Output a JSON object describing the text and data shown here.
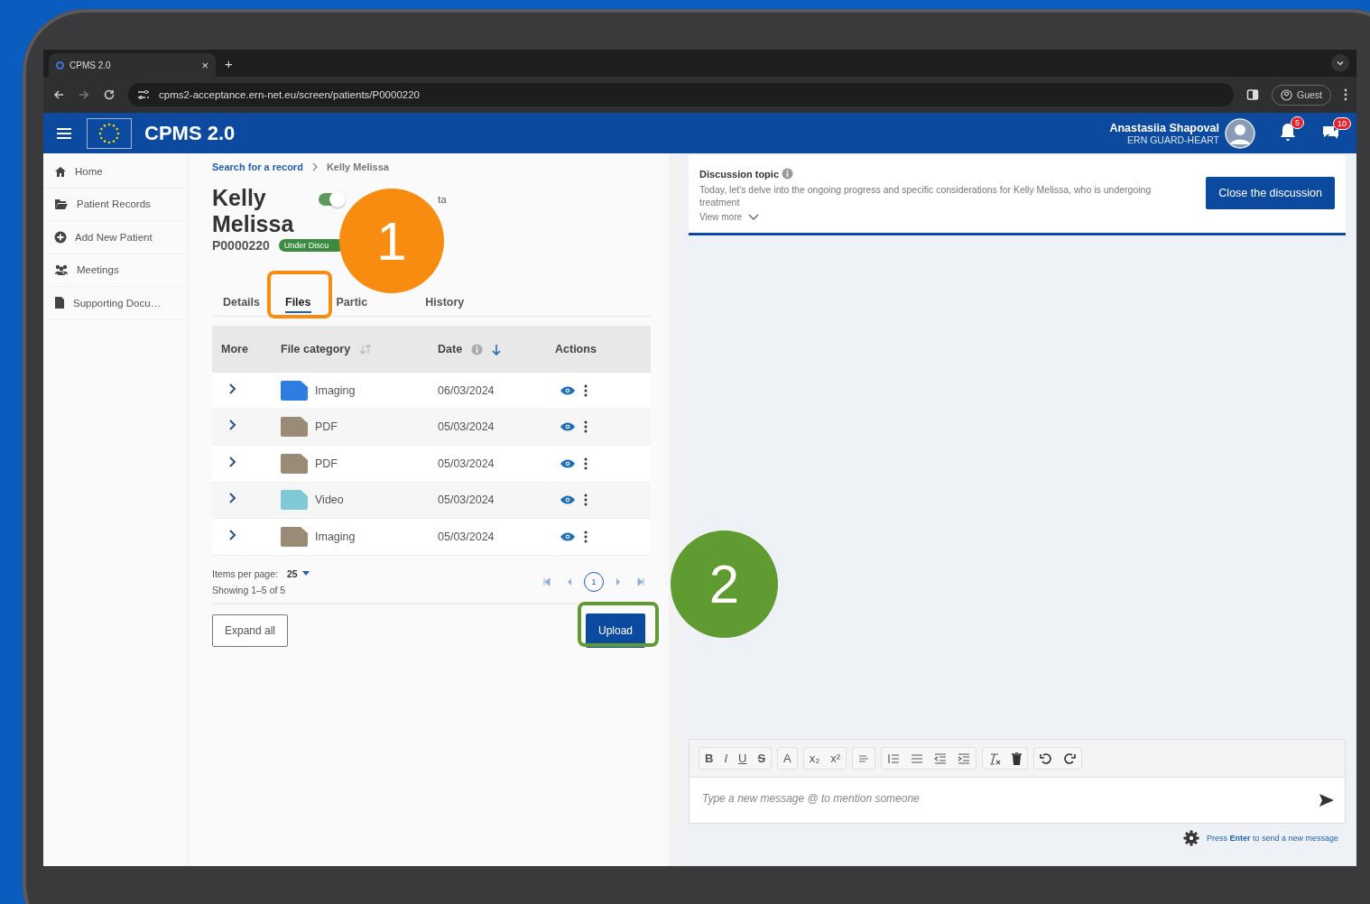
{
  "browser": {
    "tab_title": "CPMS 2.0",
    "tab_close": "×",
    "new_tab": "+",
    "url": "cpms2-acceptance.ern-net.eu/screen/patients/P0000220",
    "profile": "Guest"
  },
  "app": {
    "title": "CPMS 2.0",
    "user_name": "Anastasiia Shapoval",
    "user_org": "ERN GUARD-HEART",
    "notifications": "5",
    "messages": "10"
  },
  "sidebar": {
    "items": [
      {
        "label": "Home"
      },
      {
        "label": "Patient Records"
      },
      {
        "label": "Add New Patient"
      },
      {
        "label": "Meetings"
      },
      {
        "label": "Supporting Docu…"
      }
    ]
  },
  "breadcrumb": [
    {
      "label": "Search for a record",
      "kind": "link"
    },
    {
      "label": "Kelly Melissa",
      "kind": "current"
    }
  ],
  "patient": {
    "first_name": "Kelly",
    "last_name": "Melissa",
    "id": "P0000220",
    "status": "Under Discu",
    "toggle": {
      "on": true,
      "label": "ta"
    }
  },
  "tabs": [
    {
      "label": "Details",
      "selected": false
    },
    {
      "label": "Files",
      "selected": true
    },
    {
      "label": "Partic",
      "selected": false
    },
    {
      "label": "History",
      "selected": false
    }
  ],
  "table": {
    "columns": [
      "More",
      "File category",
      "Date",
      "Actions"
    ],
    "rows": [
      {
        "category": "Imaging",
        "date": "06/03/2024",
        "color": "#2f7de1"
      },
      {
        "category": "PDF",
        "date": "05/03/2024",
        "color": "#9a8b76"
      },
      {
        "category": "PDF",
        "date": "05/03/2024",
        "color": "#9a8b76"
      },
      {
        "category": "Video",
        "date": "05/03/2024",
        "color": "#7fc8d6"
      },
      {
        "category": "Imaging",
        "date": "05/03/2024",
        "color": "#9a8b76"
      }
    ]
  },
  "pagination": {
    "items_per_page_label": "Items per page:",
    "items_per_page": "25",
    "showing": "Showing 1–5 of 5",
    "page": "1"
  },
  "buttons": {
    "expand_all": "Expand all",
    "upload": "Upload"
  },
  "discussion": {
    "title": "Discussion topic",
    "text": "Today, let's delve into the ongoing progress and specific considerations for Kelly Melissa, who is undergoing treatment",
    "view_more": "View more",
    "close_button": "Close the discussion"
  },
  "editor": {
    "text_tools": [
      [
        "B",
        "I",
        "U",
        "S"
      ],
      [
        "A"
      ],
      [
        "x₂",
        "x²"
      ]
    ],
    "placeholder": "Type a new message @ to mention someone",
    "hint": "Press **Enter** to send a new message"
  },
  "callouts": [
    {
      "number": "1",
      "color": "#f78c10"
    },
    {
      "number": "2",
      "color": "#5f9b30"
    }
  ]
}
